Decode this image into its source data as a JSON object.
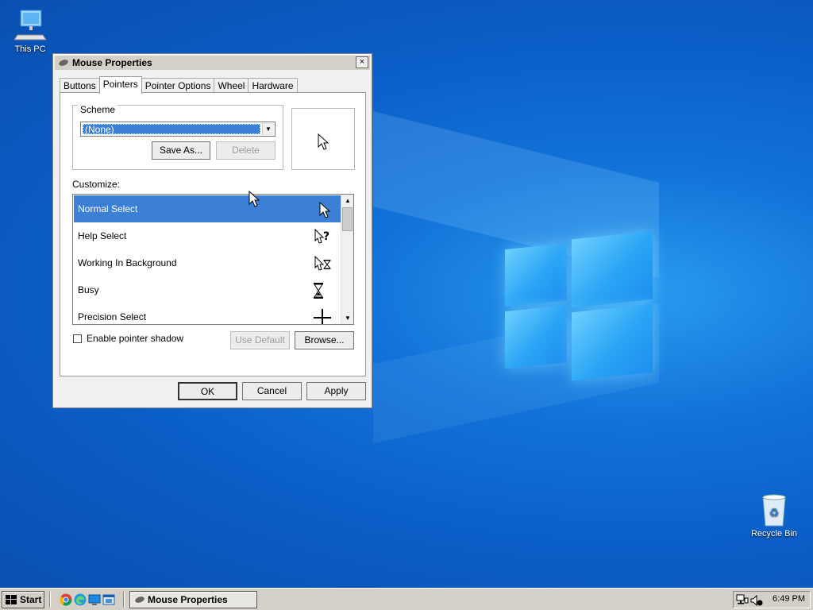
{
  "desktop": {
    "icons": [
      {
        "label": "This PC"
      },
      {
        "label": "Recycle Bin"
      }
    ]
  },
  "dialog": {
    "title": "Mouse Properties",
    "close_label": "×",
    "tabs": [
      {
        "label": "Buttons",
        "active": false
      },
      {
        "label": "Pointers",
        "active": true
      },
      {
        "label": "Pointer Options",
        "active": false
      },
      {
        "label": "Wheel",
        "active": false
      },
      {
        "label": "Hardware",
        "active": false
      }
    ],
    "scheme": {
      "label": "Scheme",
      "selected": "(None)",
      "save_as": "Save As...",
      "delete": "Delete"
    },
    "customize": {
      "label": "Customize:",
      "items": [
        {
          "label": "Normal Select",
          "icon": "arrow-cursor-icon",
          "selected": true
        },
        {
          "label": "Help Select",
          "icon": "help-cursor-icon",
          "selected": false
        },
        {
          "label": "Working In Background",
          "icon": "working-cursor-icon",
          "selected": false
        },
        {
          "label": "Busy",
          "icon": "hourglass-cursor-icon",
          "selected": false
        },
        {
          "label": "Precision Select",
          "icon": "crosshair-cursor-icon",
          "selected": false
        }
      ]
    },
    "shadow_label": "Enable pointer shadow",
    "use_default": "Use Default",
    "browse": "Browse...",
    "ok": "OK",
    "cancel": "Cancel",
    "apply": "Apply"
  },
  "taskbar": {
    "start_label": "Start",
    "task_label": "Mouse Properties",
    "clock": "6:49 PM"
  },
  "colors": {
    "selection": "#3b7fd6",
    "desktop_blue": "#0b5fc8"
  }
}
